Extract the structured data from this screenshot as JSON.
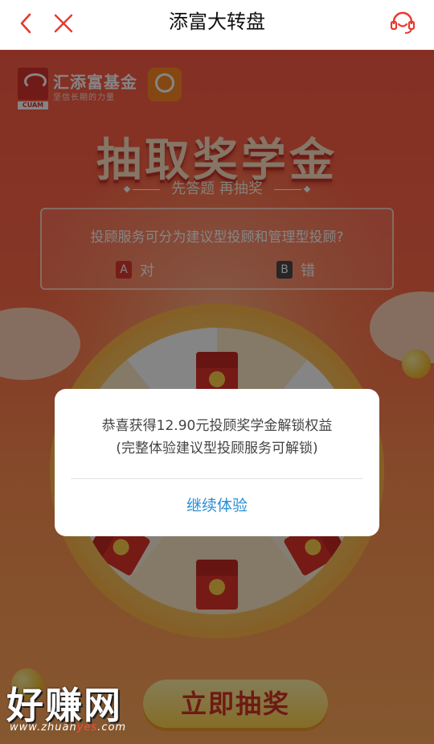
{
  "topbar": {
    "title": "添富大转盘",
    "back_icon": "chevron-left-icon",
    "close_icon": "close-icon",
    "service_icon": "headset-icon"
  },
  "brand": {
    "name": "汇添富基金",
    "slogan": "坚信长期的力量",
    "logo_abbr": "CUAM"
  },
  "hero": {
    "title": "抽取奖学金",
    "subtitle": "先答题 再抽奖"
  },
  "quiz": {
    "question": "投顾服务可分为建议型投顾和管理型投顾?",
    "options": [
      {
        "key": "A",
        "label": "对",
        "color": "#e03a2e"
      },
      {
        "key": "B",
        "label": "错",
        "color": "#4a4a4a"
      }
    ]
  },
  "wheel": {
    "cta_label": "立即抽奖"
  },
  "dialog": {
    "line1": "恭喜获得12.90元投顾奖学金解锁权益",
    "line2": "(完整体验建议型投顾服务可解锁)",
    "button_label": "继续体验"
  },
  "watermark": {
    "main": "好赚网",
    "url_prefix": "www.zhuan",
    "url_highlight": "yes",
    "url_suffix": ".com"
  },
  "colors": {
    "accent_red": "#e8392d",
    "dialog_button": "#2a8fd6",
    "scene_top": "#ff5b45",
    "scene_bottom": "#ffa95b"
  }
}
